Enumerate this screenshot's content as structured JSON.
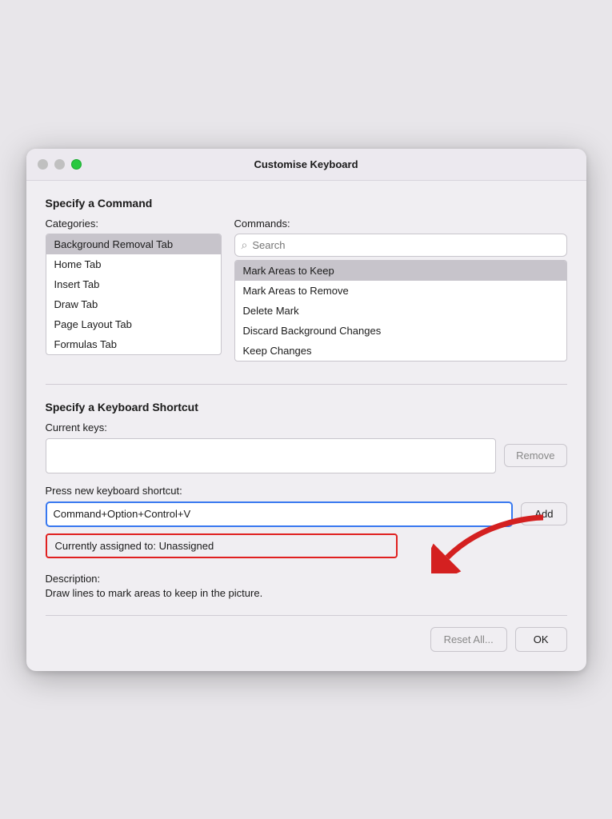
{
  "window": {
    "title": "Customise Keyboard"
  },
  "traffic_lights": {
    "close_color": "#c0c0c0",
    "minimize_color": "#c0c0c0",
    "maximize_color": "#28c840"
  },
  "command_section": {
    "title": "Specify a Command",
    "categories_label": "Categories:",
    "commands_label": "Commands:",
    "categories": [
      {
        "label": "Background Removal Tab",
        "selected": true
      },
      {
        "label": "Home Tab",
        "selected": false
      },
      {
        "label": "Insert Tab",
        "selected": false
      },
      {
        "label": "Draw Tab",
        "selected": false
      },
      {
        "label": "Page Layout Tab",
        "selected": false
      },
      {
        "label": "Formulas Tab",
        "selected": false
      }
    ],
    "search_placeholder": "Search",
    "commands": [
      {
        "label": "Mark Areas to Keep",
        "selected": true
      },
      {
        "label": "Mark Areas to Remove",
        "selected": false
      },
      {
        "label": "Delete Mark",
        "selected": false
      },
      {
        "label": "Discard Background Changes",
        "selected": false
      },
      {
        "label": "Keep Changes",
        "selected": false
      }
    ]
  },
  "shortcut_section": {
    "title": "Specify a Keyboard Shortcut",
    "current_keys_label": "Current keys:",
    "remove_button": "Remove",
    "press_shortcut_label": "Press new keyboard shortcut:",
    "shortcut_value": "Command+Option+Control+V",
    "add_button": "Add",
    "assigned_text": "Currently assigned to:  Unassigned",
    "description_label": "Description:",
    "description_text": "Draw lines to mark areas to keep in the picture."
  },
  "footer": {
    "reset_button": "Reset All...",
    "ok_button": "OK"
  }
}
